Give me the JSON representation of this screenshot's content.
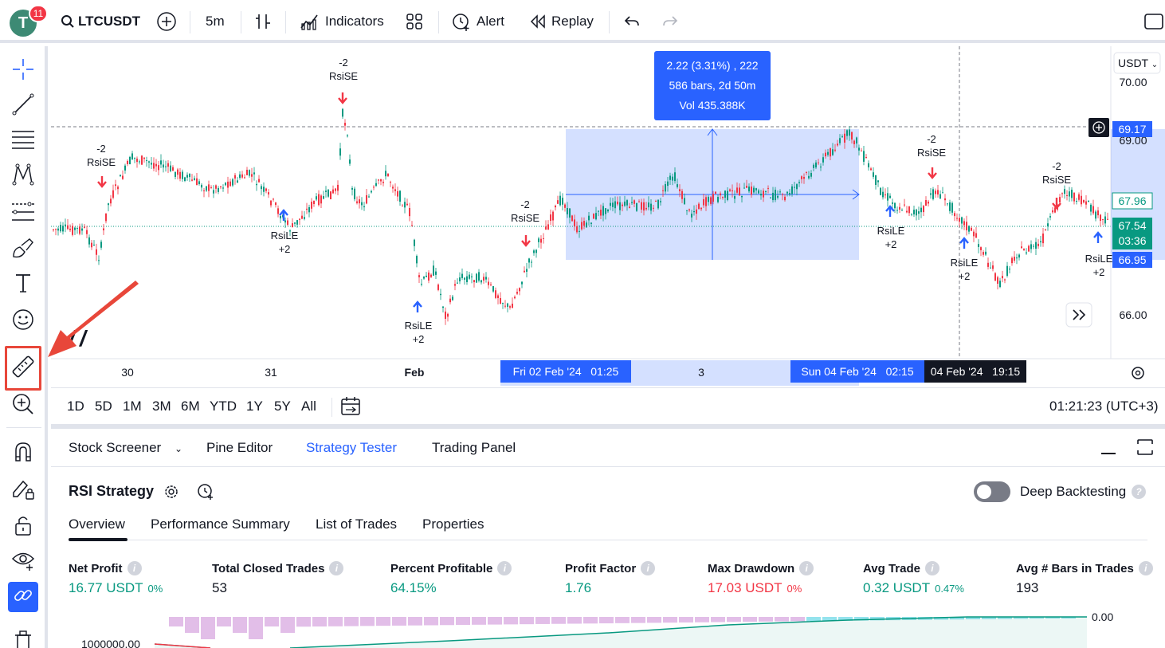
{
  "topbar": {
    "avatar_letter": "T",
    "notifications": "11",
    "symbol": "LTCUSDT",
    "interval": "5m",
    "indicators": "Indicators",
    "alert": "Alert",
    "replay": "Replay",
    "icons": [
      "search-icon",
      "add-symbol-icon",
      "bar-style-icon",
      "indicators-icon",
      "templates-icon",
      "alert-icon",
      "replay-icon",
      "undo-icon",
      "redo-icon",
      "fullscreen-icon"
    ]
  },
  "leftbar": {
    "icons": [
      "crosshair-icon",
      "trendline-icon",
      "fib-icon",
      "pattern-icon",
      "forecast-icon",
      "brush-icon",
      "text-icon",
      "emoji-icon",
      "ruler-icon",
      "zoom-in-icon",
      "magnet-icon",
      "lock-drawing-icon",
      "unlock-icon",
      "eye-icon",
      "link-icon",
      "trash-icon"
    ]
  },
  "chart": {
    "currency": "USDT",
    "measure": {
      "line1": "2.22 (3.31%) , 222",
      "line2": "586 bars, 2d 50m",
      "line3": "Vol 435.388K"
    },
    "price_labels": [
      {
        "text": "70.00"
      },
      {
        "text": "69.00"
      },
      {
        "text": "66.00"
      }
    ],
    "badges": {
      "cursor_price": "69.17",
      "level": "67.96",
      "last": "67.54",
      "countdown": "03:36",
      "low": "66.95"
    },
    "time_labels": [
      "30",
      "31",
      "Feb",
      "3"
    ],
    "time_badges": {
      "start": "Fri 02 Feb '24   01:25",
      "end": "Sun 04 Feb '24   02:15",
      "cursor": "04 Feb '24   19:15"
    },
    "signals": [
      {
        "line1": "-2",
        "line2": "RsiSE"
      },
      {
        "line1": "-2",
        "line2": "RsiSE"
      },
      {
        "line1": "RsiLE",
        "line2": "+2"
      },
      {
        "line1": "RsiLE",
        "line2": "+2"
      },
      {
        "line1": "-2",
        "line2": "RsiSE"
      },
      {
        "line1": "-2",
        "line2": "RsiSE"
      },
      {
        "line1": "RsiLE",
        "line2": "+2"
      },
      {
        "line1": "RsiLE",
        "line2": "+2"
      },
      {
        "line1": "-2",
        "line2": "RsiSE"
      },
      {
        "line1": "RsiLE",
        "line2": "+2"
      }
    ]
  },
  "rangebar": {
    "ranges": [
      "1D",
      "5D",
      "1M",
      "3M",
      "6M",
      "YTD",
      "1Y",
      "5Y",
      "All"
    ],
    "clock": "01:21:23 (UTC+3)"
  },
  "panel": {
    "tabs": [
      "Stock Screener",
      "Pine Editor",
      "Strategy Tester",
      "Trading Panel"
    ],
    "strategy_name": "RSI Strategy",
    "deep_backtesting": "Deep Backtesting",
    "subtabs": [
      "Overview",
      "Performance Summary",
      "List of Trades",
      "Properties"
    ],
    "metrics": [
      {
        "label": "Net Profit",
        "value": "16.77 USDT",
        "pct": "0%",
        "color": "#089981"
      },
      {
        "label": "Total Closed Trades",
        "value": "53",
        "pct": "",
        "color": "#131722"
      },
      {
        "label": "Percent Profitable",
        "value": "64.15%",
        "pct": "",
        "color": "#089981"
      },
      {
        "label": "Profit Factor",
        "value": "1.76",
        "pct": "",
        "color": "#089981"
      },
      {
        "label": "Max Drawdown",
        "value": "17.03 USDT",
        "pct": "0%",
        "color": "#f23645"
      },
      {
        "label": "Avg Trade",
        "value": "0.32 USDT",
        "pct": "0.47%",
        "color": "#089981"
      },
      {
        "label": "Avg # Bars in Trades",
        "value": "193",
        "pct": "",
        "color": "#131722"
      }
    ],
    "equity_right_label": "0.00",
    "equity_left_label": "1000000.00"
  },
  "colors": {
    "accent": "#2962ff",
    "up": "#089981",
    "down": "#f23645",
    "highlight_box": "#e8473a"
  }
}
